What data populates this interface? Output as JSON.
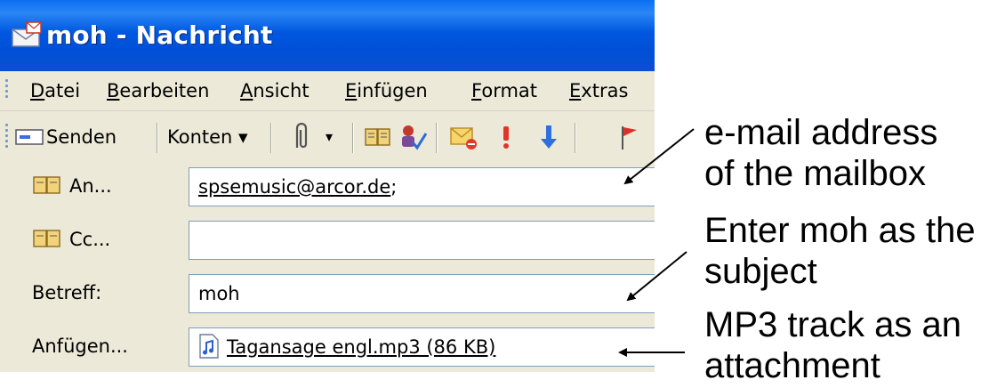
{
  "window": {
    "title": "moh - Nachricht"
  },
  "menu": {
    "items": [
      "Datei",
      "Bearbeiten",
      "Ansicht",
      "Einfügen",
      "Format",
      "Extras"
    ]
  },
  "toolbar": {
    "send_label": "Senden",
    "accounts_label": "Konten ▾",
    "attach_dropdown": "▾",
    "icons": [
      "send-icon",
      "paperclip-icon",
      "address-book-icon",
      "check-names-icon",
      "mark-message-icon",
      "high-importance-icon",
      "low-importance-icon",
      "flag-icon"
    ]
  },
  "form": {
    "to_label": "An...",
    "to_value": "spsemusic@arcor.de",
    "to_suffix": ";",
    "cc_label": "Cc...",
    "cc_value": "",
    "subject_label": "Betreff:",
    "subject_value": "moh",
    "attach_label": "Anfügen...",
    "attach_value": "Tagansage engl.mp3 (86 KB)"
  },
  "annotations": {
    "email_line1": "e-mail address",
    "email_line2": "of the mailbox",
    "subject_line1": "Enter moh as the",
    "subject_line2": "subject",
    "attach_line1": "MP3 track as an",
    "attach_line2": "attachment"
  },
  "colors": {
    "titlebar": "#0058e0",
    "window_bg": "#ece9d8",
    "field_border": "#7f9db9"
  }
}
